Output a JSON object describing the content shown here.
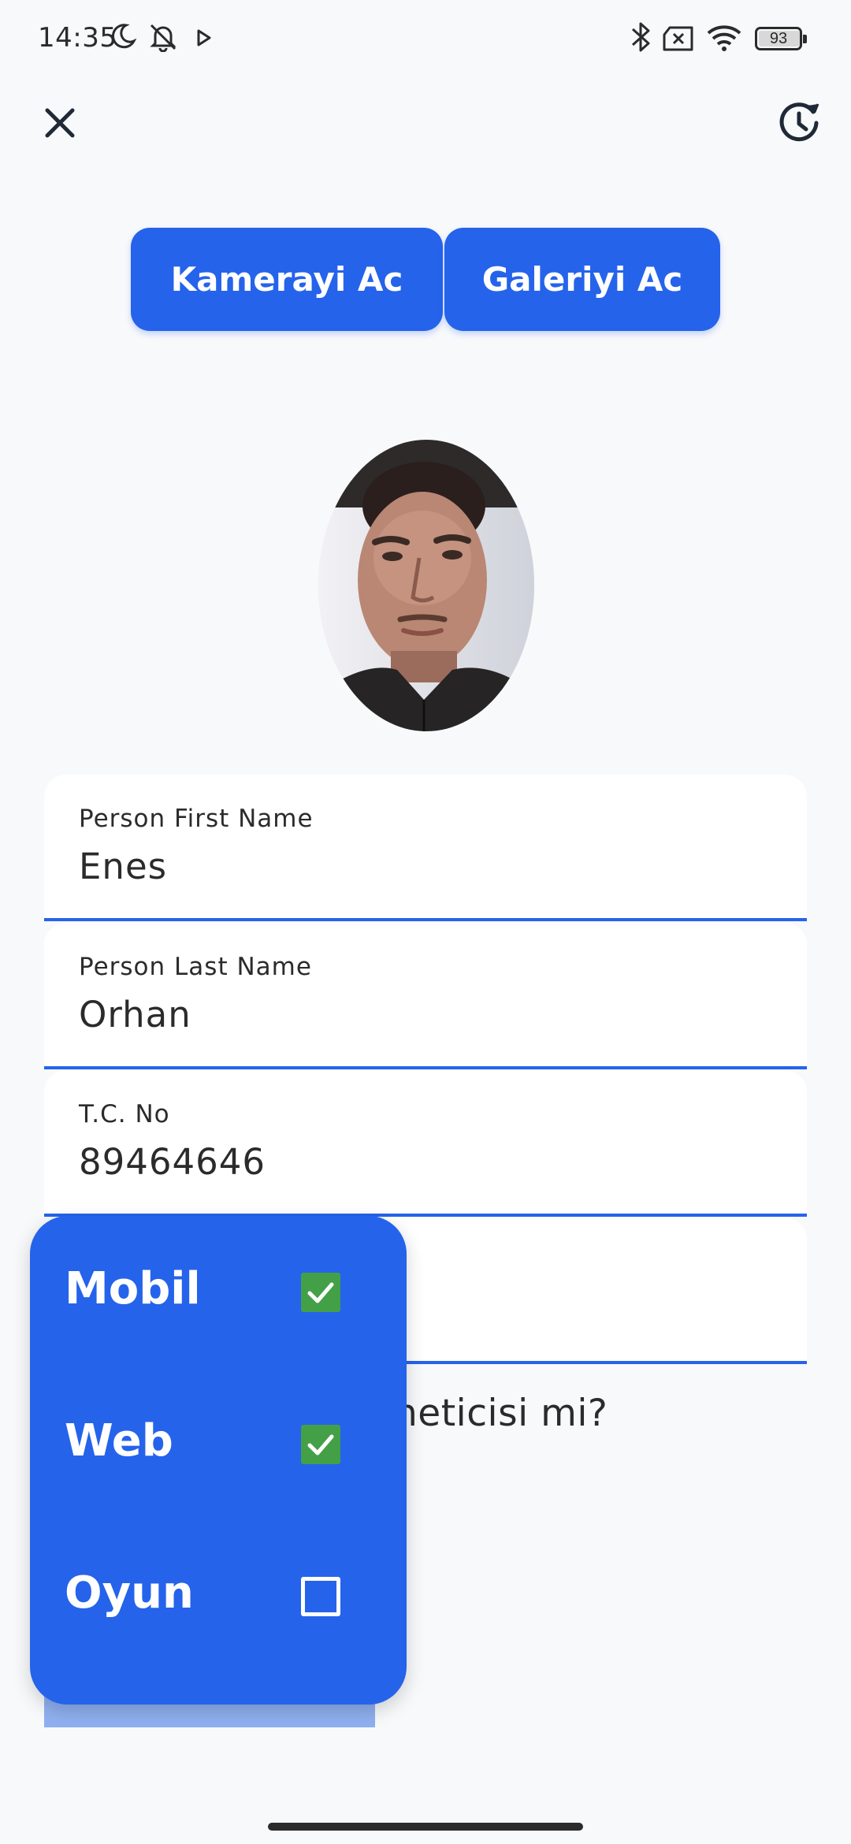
{
  "status_bar": {
    "time": "14:35",
    "battery": "93",
    "icons": [
      "moon-icon",
      "bell-off-icon",
      "play-icon",
      "bluetooth-icon",
      "sim-x-icon",
      "wifi-icon",
      "battery-icon"
    ]
  },
  "toolbar": {
    "close_icon": "close-icon",
    "history_icon": "history-icon"
  },
  "buttons": {
    "camera": "Kamerayi Ac",
    "gallery": "Galeriyi Ac"
  },
  "form": {
    "first_name": {
      "label": "Person First Name",
      "value": "Enes"
    },
    "last_name": {
      "label": "Person Last Name",
      "value": "Orhan"
    },
    "tc_no": {
      "label": "T.C. No",
      "value": "89464646"
    },
    "question_partial": "neticisi mi?"
  },
  "menu": {
    "items": [
      {
        "label": "Mobil",
        "checked": true
      },
      {
        "label": "Web",
        "checked": true
      },
      {
        "label": "Oyun",
        "checked": false
      }
    ]
  },
  "colors": {
    "accent": "#2563eb",
    "check": "#43a047",
    "background": "#f8f9fb"
  }
}
